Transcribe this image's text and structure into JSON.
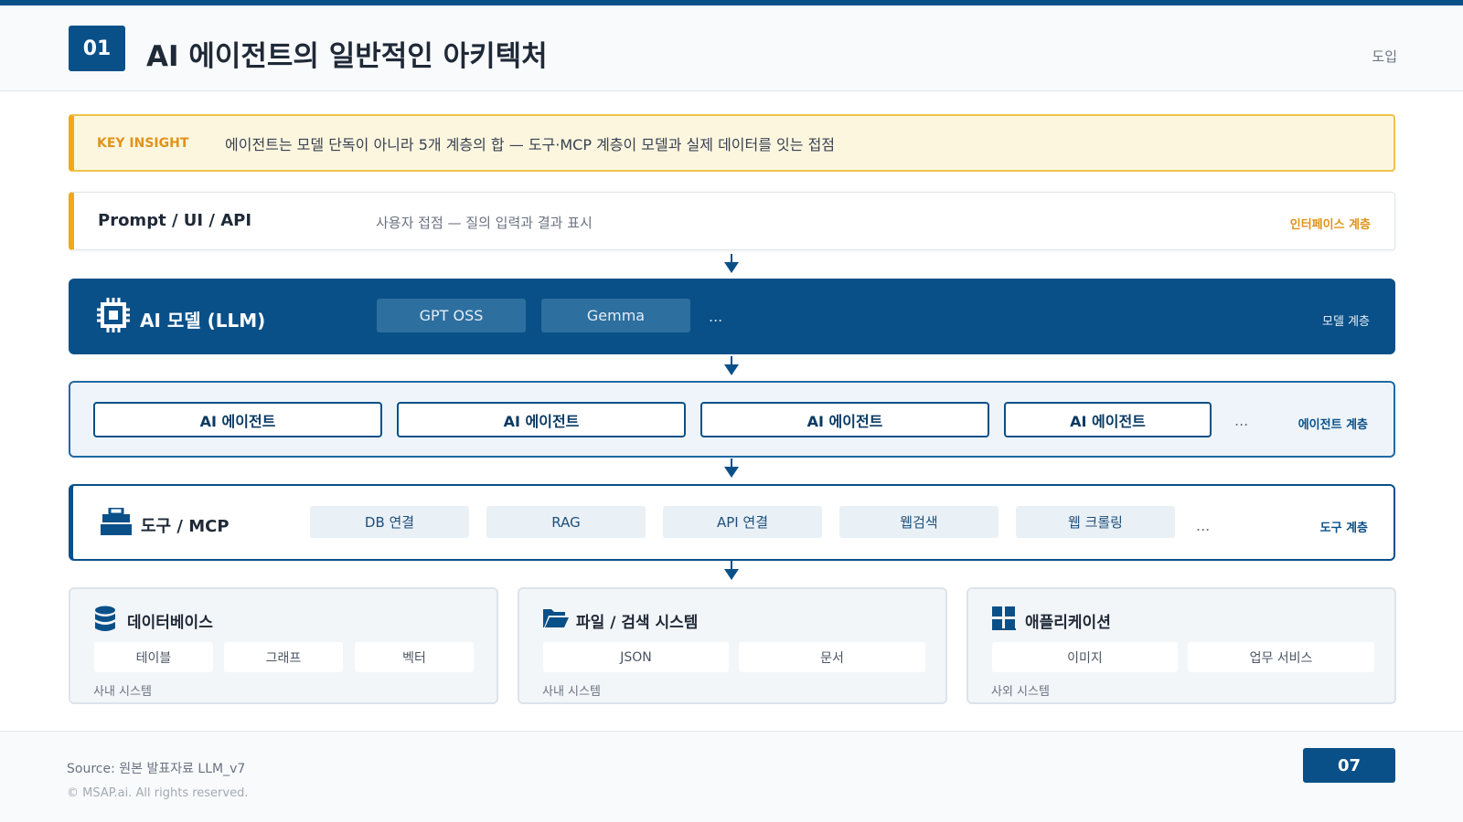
{
  "header": {
    "section_number": "01",
    "title": "AI 에이전트의 일반적인 아키텍처",
    "section_tag": "도입"
  },
  "insight": {
    "label": "KEY INSIGHT",
    "text": "에이전트는 모델 단독이 아니라 5개 계층의 합 — 도구·MCP 계층이 모델과 실제 데이터를 잇는 접점"
  },
  "layers": {
    "interface": {
      "title": "Prompt / UI / API",
      "description": "사용자 접점 — 질의 입력과 결과 표시",
      "tag": "인터페이스 계층"
    },
    "model": {
      "title": "AI 모델 (LLM)",
      "chips": [
        "GPT OSS",
        "Gemma"
      ],
      "ellipsis": "...",
      "tag": "모델 계층"
    },
    "agent": {
      "agents": [
        "AI 에이전트",
        "AI 에이전트",
        "AI 에이전트",
        "AI 에이전트"
      ],
      "ellipsis": "...",
      "tag": "에이전트 계층"
    },
    "tools": {
      "title": "도구 / MCP",
      "chips": [
        "DB 연결",
        "RAG",
        "API 연결",
        "웹검색",
        "웹 크롤링"
      ],
      "ellipsis": "...",
      "tag": "도구 계층"
    },
    "data": [
      {
        "title": "데이터베이스",
        "icon": "database-icon",
        "items": [
          "테이블",
          "그래프",
          "벡터"
        ],
        "footer": "사내 시스템"
      },
      {
        "title": "파일 / 검색 시스템",
        "icon": "folder-icon",
        "items": [
          "JSON",
          "문서"
        ],
        "footer": "사내 시스템"
      },
      {
        "title": "애플리케이션",
        "icon": "apps-grid-icon",
        "items": [
          "이미지",
          "업무 서비스"
        ],
        "footer": "사외 시스템"
      }
    ]
  },
  "footer": {
    "source": "Source: 원본 발표자료 LLM_v7",
    "copyright": "© MSAP.ai. All rights reserved.",
    "page_number": "07"
  },
  "colors": {
    "primary": "#0a5088",
    "accent": "#f2a81d",
    "insight_bg": "#fdf6df"
  }
}
